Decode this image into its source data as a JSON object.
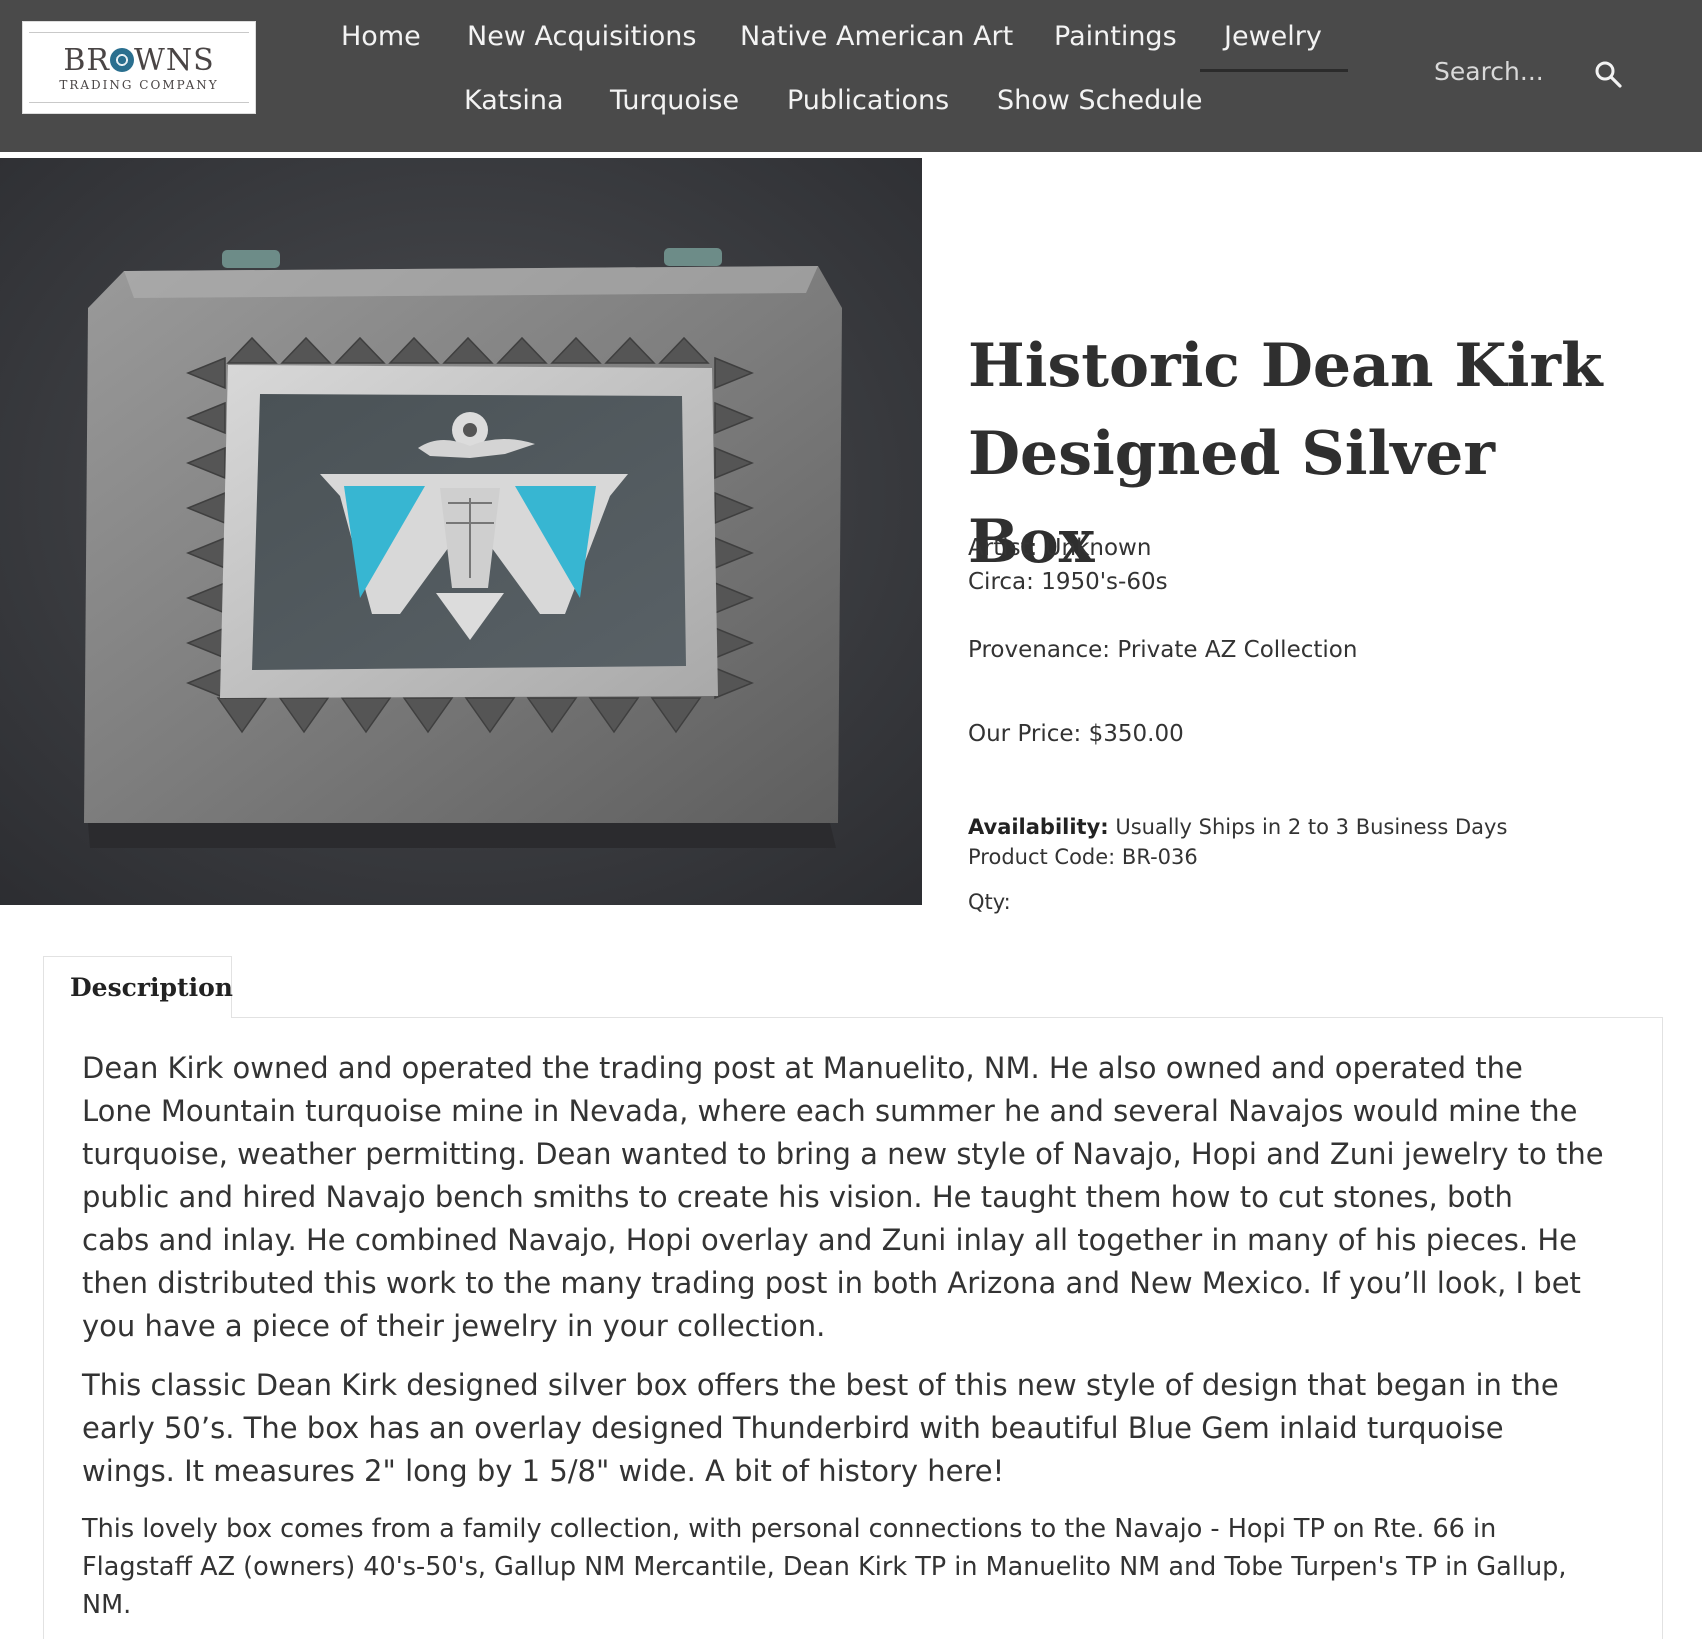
{
  "brand": {
    "name_before": "BR",
    "name_after": "WNS",
    "subtitle": "TRADING COMPANY"
  },
  "nav": {
    "items": [
      {
        "label": "Home"
      },
      {
        "label": "New Acquisitions"
      },
      {
        "label": "Native American Art"
      },
      {
        "label": "Paintings"
      },
      {
        "label": "Jewelry",
        "active": true
      },
      {
        "label": "Katsina"
      },
      {
        "label": "Turquoise"
      },
      {
        "label": "Publications"
      },
      {
        "label": "Show Schedule"
      }
    ]
  },
  "search": {
    "placeholder": "Search...",
    "icon": "search-icon"
  },
  "product": {
    "title_line1": "Historic Dean Kirk",
    "title_line2": "Designed Silver Box",
    "artist": "Artist: Unknown",
    "circa": "Circa: 1950's-60s",
    "provenance": "Provenance: Private AZ Collection",
    "price": "Our Price: $350.00",
    "availability_label": "Availability:",
    "availability_value": " Usually Ships in 2 to 3 Business Days",
    "product_code": "Product Code: BR-036",
    "qty_label": "Qty:"
  },
  "tabs": [
    {
      "label": "Description",
      "active": true
    }
  ],
  "description": {
    "p1": [
      "Dean Kirk owned and operated the trading post at Manuelito, NM. He also owned and operated the",
      "Lone Mountain turquoise mine in Nevada, where each summer he and several Navajos would mine the",
      "turquoise, weather permitting. Dean wanted to bring a new style of Navajo, Hopi and Zuni jewelry to the",
      "public and hired Navajo bench smiths to create his vision. He taught them how to cut stones, both",
      "cabs and inlay. He combined Navajo, Hopi overlay and Zuni inlay all together in many of his pieces. He",
      "then distributed this work to the many trading post in both Arizona and New Mexico. If you’ll look, I bet",
      "you have a piece of their jewelry in your collection."
    ],
    "p2": [
      "This classic Dean Kirk designed silver box offers the best of this new style of design that began in the",
      "early 50’s. The box has an overlay designed Thunderbird with beautiful Blue Gem inlaid turquoise",
      "wings. It measures 2\" long by 1 5/8\" wide. A bit of history here!"
    ],
    "p3": [
      "This lovely box comes from a family collection, with personal connections to the Navajo - Hopi TP on Rte. 66 in",
      "Flagstaff AZ (owners) 40's-50's, Gallup NM Mercantile, Dean Kirk TP in Manuelito NM and Tobe Turpen's TP in Gallup,",
      "NM."
    ]
  },
  "colors": {
    "header_bg": "#4a4a4a",
    "turquoise": "#37b6d2",
    "text": "#333333"
  }
}
